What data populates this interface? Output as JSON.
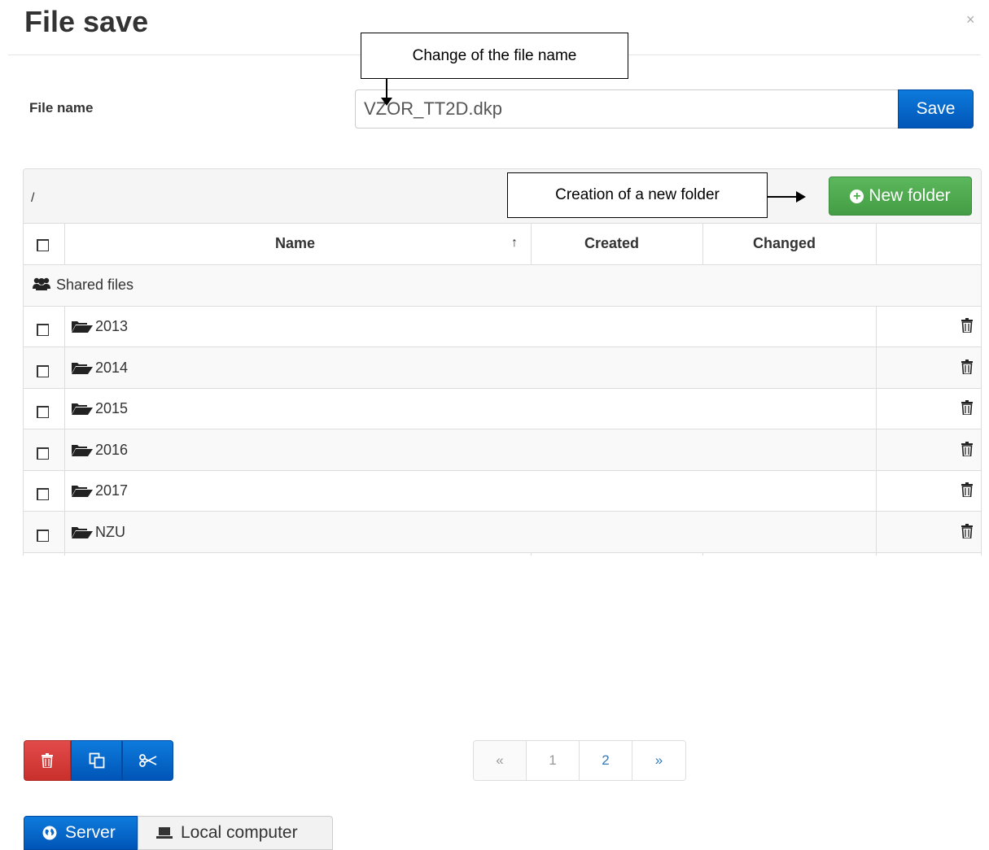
{
  "dialog": {
    "title": "File save",
    "close_glyph": "×"
  },
  "annotations": {
    "file_name_callout": "Change of the file name",
    "new_folder_callout": "Creation of a new folder"
  },
  "file_name": {
    "label": "File name",
    "value": "VZOR_TT2D.dkp",
    "save_label": "Save"
  },
  "browser": {
    "path": "/",
    "new_folder_label": "New folder",
    "columns": {
      "name": "Name",
      "sort_indicator": "↑",
      "created": "Created",
      "changed": "Changed"
    },
    "shared_label": "Shared files",
    "folders": [
      {
        "name": "2013"
      },
      {
        "name": "2014"
      },
      {
        "name": "2015"
      },
      {
        "name": "2016"
      },
      {
        "name": "2017"
      },
      {
        "name": "NZU"
      }
    ]
  },
  "pagination": {
    "prev": "«",
    "pages": [
      "1",
      "2"
    ],
    "current_page": "1",
    "next": "»"
  },
  "source_tabs": {
    "server": "Server",
    "local": "Local computer",
    "active": "server"
  },
  "colors": {
    "primary": "#0d6fd3",
    "success": "#5cb85c",
    "danger": "#d9534f"
  }
}
